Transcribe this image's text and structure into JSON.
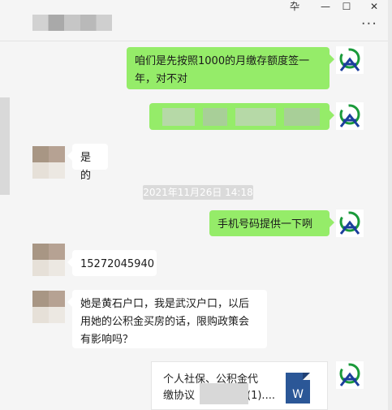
{
  "window": {
    "pin_glyph": "卆",
    "minimize_glyph": "—",
    "maximize_glyph": "☐",
    "close_glyph": "✕",
    "more_glyph": "···"
  },
  "messages": {
    "m1": "咱们是先按照1000的月缴存额度签一年，对不对",
    "m3": "是的",
    "timestamp": "2021年11月26日 14:18",
    "m4": "手机号码提供一下咧",
    "m5": "15272045940",
    "m6": "她是黄石户口，我是武汉户口，以后用她的公积金买房的话，限购政策会有影响吗？",
    "file_title_1": "个人社保、公积金代",
    "file_title_2": "缴协议",
    "file_title_suffix": "(1)....",
    "doc_letter": "W"
  },
  "colors": {
    "my_bubble": "#95ec69",
    "their_bubble": "#ffffff",
    "background": "#f5f5f5",
    "doc_blue": "#2b5797"
  }
}
